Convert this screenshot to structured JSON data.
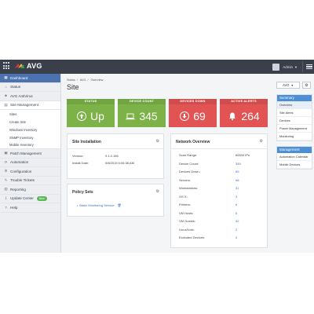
{
  "topbar": {
    "brand": "AVG",
    "user": "Admin"
  },
  "sidebar": {
    "items": [
      {
        "label": "Dashboard",
        "icon": "dashboard-icon"
      },
      {
        "label": "Status",
        "icon": "home-icon"
      },
      {
        "label": "AVG AntiVirus",
        "icon": "shield-icon"
      },
      {
        "label": "Site Management",
        "icon": "sitemap-icon"
      },
      {
        "label": "Sites"
      },
      {
        "label": "Create Site"
      },
      {
        "label": "Windows Inventory"
      },
      {
        "label": "SNMP Inventory"
      },
      {
        "label": "Mobile Inventory"
      },
      {
        "label": "Patch Management",
        "icon": "patch-icon"
      },
      {
        "label": "Automation",
        "icon": "automation-icon"
      },
      {
        "label": "Configuration",
        "icon": "gear-icon"
      },
      {
        "label": "Trouble Tickets",
        "icon": "ticket-icon"
      },
      {
        "label": "Reporting",
        "icon": "chart-icon"
      },
      {
        "label": "Update Center",
        "icon": "download-icon",
        "badge": "New"
      },
      {
        "label": "Help",
        "icon": "help-icon"
      }
    ]
  },
  "breadcrumb": [
    "Status",
    "AVG",
    "Overview"
  ],
  "page_title": "Site",
  "tiles": [
    {
      "head": "STATUS",
      "value": "Up",
      "color": "#7db249",
      "icon": "thumbs-up-icon"
    },
    {
      "head": "DEVICE COUNT",
      "value": "345",
      "color": "#7db249",
      "icon": "laptop-icon"
    },
    {
      "head": "DEVICES DOWN",
      "value": "69",
      "color": "#e25454",
      "icon": "down-arrow-icon"
    },
    {
      "head": "ACTIVE ALERTS",
      "value": "264",
      "color": "#e25454",
      "icon": "bell-icon"
    }
  ],
  "site_installation": {
    "title": "Site Installation",
    "rows": [
      {
        "k": "Version:",
        "v": "9.1.0.166"
      },
      {
        "k": "Install Date:",
        "v": "5/8/2015 6:06:38 AM"
      }
    ]
  },
  "policy_sets": {
    "title": "Policy Sets",
    "item": "Basic Monitoring Service"
  },
  "network_overview": {
    "title": "Network Overview",
    "rows": [
      {
        "k": "Scan Range:",
        "v": "65534 IPs"
      },
      {
        "k": "Device Count:",
        "v": "345"
      },
      {
        "k": "Devices Down:",
        "v": "69"
      },
      {
        "k": "Servers:",
        "v": "68"
      },
      {
        "k": "Workstations:",
        "v": "31"
      },
      {
        "k": "OS X:",
        "v": "3"
      },
      {
        "k": "Printers:",
        "v": "6"
      },
      {
        "k": "VM Hosts:",
        "v": "5"
      },
      {
        "k": "VM Guests:",
        "v": "52"
      },
      {
        "k": "Linux/Unix:",
        "v": "2"
      },
      {
        "k": "Excluded Devices:",
        "v": "0"
      }
    ]
  },
  "right": {
    "avg_button": "AVG",
    "summary": {
      "title": "Summary",
      "items": [
        "Overview",
        "Site Alerts",
        "Devices",
        "Power Management",
        "Monitoring"
      ]
    },
    "management": {
      "title": "Management",
      "items": [
        "Automation Calendar",
        "Mobile Devices"
      ]
    }
  }
}
